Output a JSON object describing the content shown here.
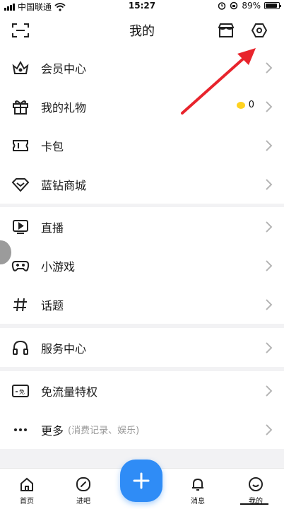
{
  "status_bar": {
    "carrier": "中国联通",
    "time": "15:27",
    "battery": "89%"
  },
  "header": {
    "title": "我的"
  },
  "groups": [
    {
      "items": [
        {
          "label": "会员中心",
          "icon": "crown-icon"
        },
        {
          "label": "我的礼物",
          "icon": "gift-icon",
          "badge_value": "0"
        },
        {
          "label": "卡包",
          "icon": "ticket-icon"
        },
        {
          "label": "蓝钻商城",
          "icon": "diamond-icon"
        }
      ]
    },
    {
      "items": [
        {
          "label": "直播",
          "icon": "live-play-icon"
        },
        {
          "label": "小游戏",
          "icon": "gamepad-icon"
        },
        {
          "label": "话题",
          "icon": "hashtag-icon"
        }
      ]
    },
    {
      "items": [
        {
          "label": "服务中心",
          "icon": "headphones-icon"
        }
      ]
    },
    {
      "items": [
        {
          "label": "免流量特权",
          "icon": "sim-card-icon"
        },
        {
          "label": "更多",
          "icon": "more-dots-icon",
          "sublabel": "(消费记录、娱乐)"
        }
      ]
    }
  ],
  "bottom_nav": {
    "tabs": [
      {
        "label": "首页",
        "icon": "home-icon"
      },
      {
        "label": "进吧",
        "icon": "compass-icon"
      },
      {
        "label": "消息",
        "icon": "bell-icon"
      },
      {
        "label": "我的",
        "icon": "profile-icon"
      }
    ],
    "fab_icon": "plus-icon"
  },
  "colors": {
    "accent": "#2f8cf6",
    "arrow": "#e8242c",
    "coin": "#ffd21f"
  }
}
